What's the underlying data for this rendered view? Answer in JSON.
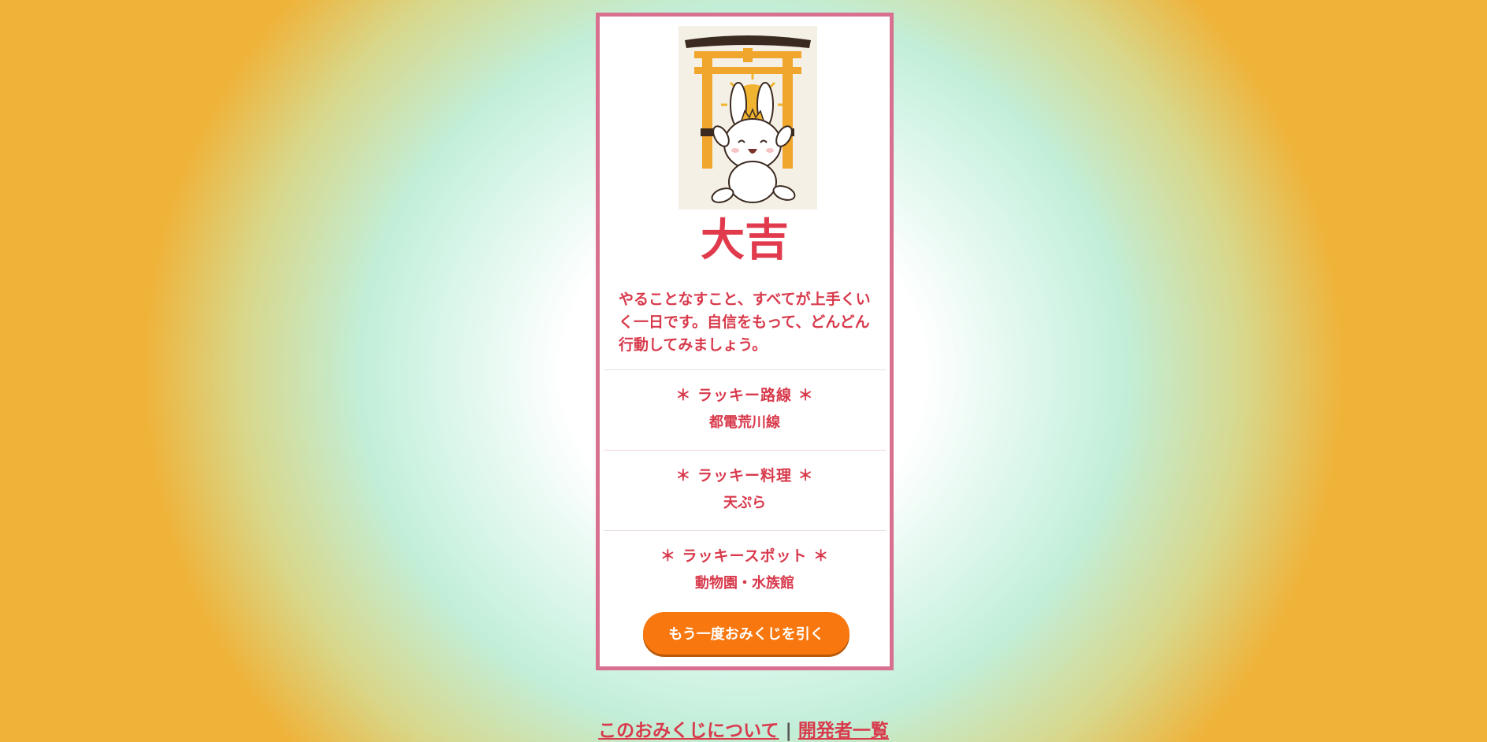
{
  "result": {
    "fortune": "大吉",
    "message": "やることなすこと、すべてが上手くいく一日です。自信をもって、どんどん行動してみましょう。"
  },
  "lucky_items": [
    {
      "title": "＊ ラッキー路線 ＊",
      "value": "都電荒川線"
    },
    {
      "title": "＊ ラッキー料理 ＊",
      "value": "天ぷら"
    },
    {
      "title": "＊ ラッキースポット ＊",
      "value": "動物園・水族館"
    }
  ],
  "retry_button_label": "もう一度おみくじを引く",
  "footer": {
    "about_link": "このおみくじについて",
    "separator": "|",
    "developers_link": "開発者一覧"
  },
  "illustration": {
    "icon": "rabbit-torii-illustration"
  },
  "colors": {
    "accent_red": "#e03a4c",
    "card_border": "#d8708f",
    "button_orange": "#f8770e"
  }
}
